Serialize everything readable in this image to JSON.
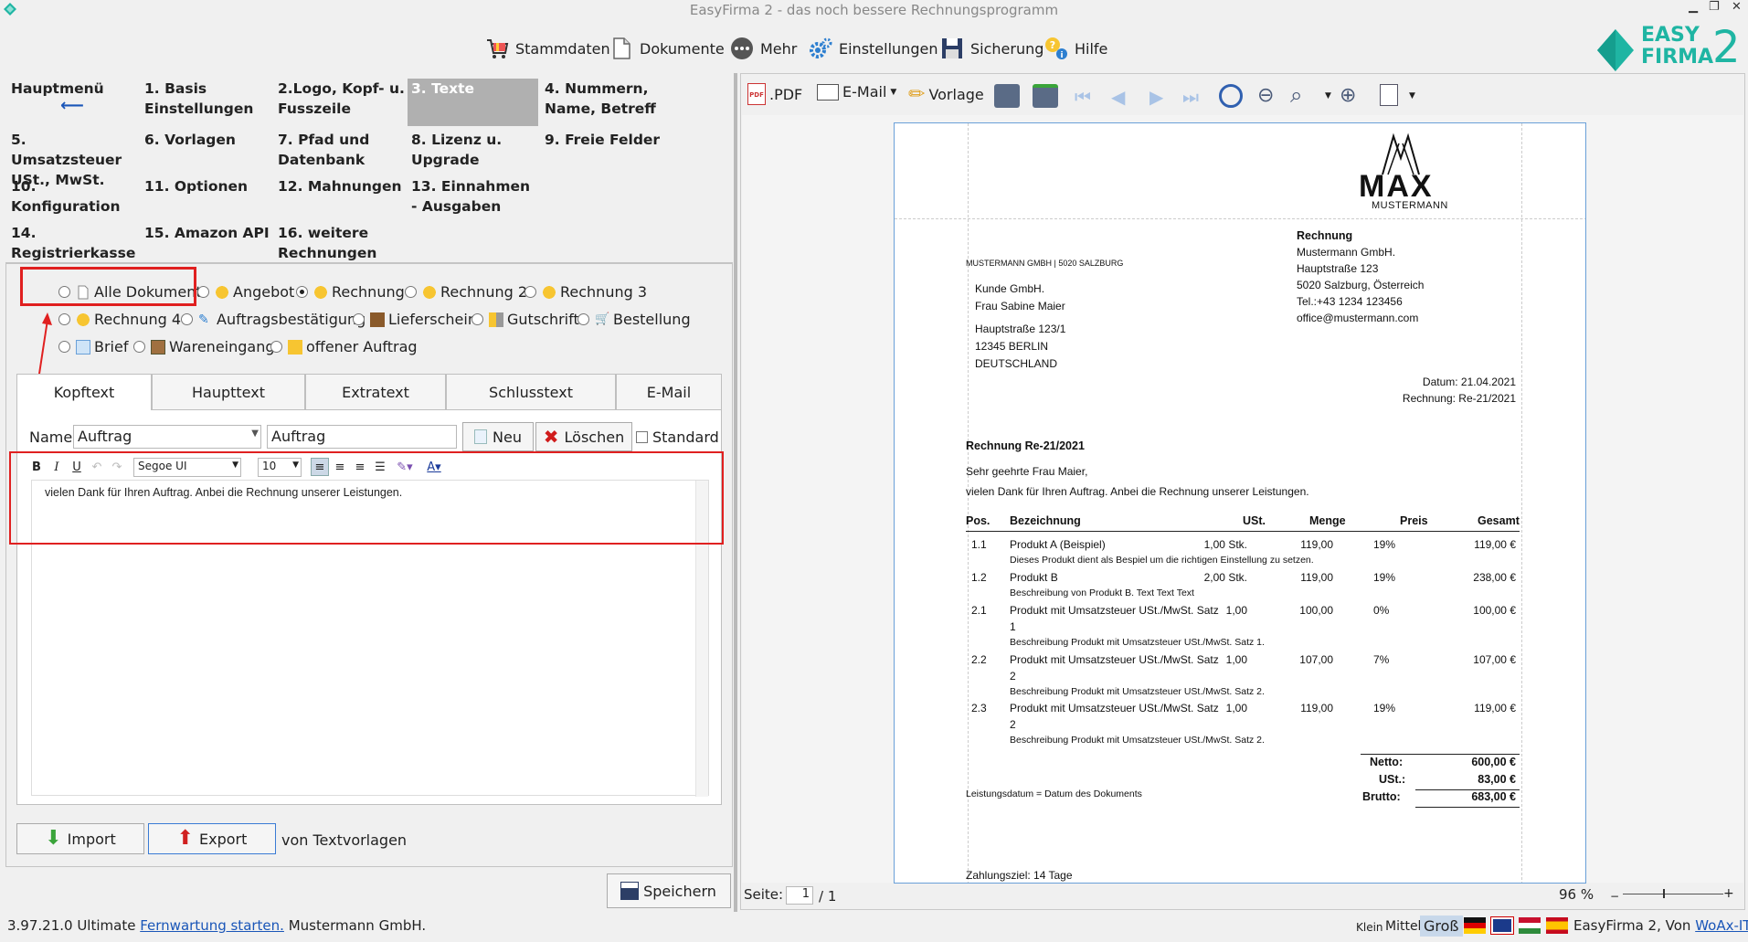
{
  "window": {
    "title": "EasyFirma 2 - das noch bessere Rechnungsprogramm",
    "logo_line1": "EASY",
    "logo_line2": "FIRMA",
    "logo_number": "2"
  },
  "toolbar": {
    "stammdaten": "Stammdaten",
    "dokumente": "Dokumente",
    "mehr": "Mehr",
    "einstellungen": "Einstellungen",
    "sicherung": "Sicherung",
    "hilfe": "Hilfe"
  },
  "nav": {
    "hauptmenu": "Hauptmenü",
    "items": [
      "1. Basis Einstellungen",
      "2.Logo, Kopf- u. Fusszeile",
      "3. Texte",
      "4. Nummern, Name, Betreff",
      "5. Umsatzsteuer USt., MwSt.",
      "6. Vorlagen",
      "7. Pfad und Datenbank",
      "8. Lizenz u. Upgrade",
      "9. Freie Felder",
      "10. Konfiguration",
      "11. Optionen",
      "12. Mahnungen",
      "13. Einnahmen - Ausgaben",
      "14. Registrierkasse",
      "15. Amazon API",
      "16. weitere Rechnungen"
    ]
  },
  "doc_types": {
    "alle": "Alle Dokument",
    "angebot": "Angebot",
    "rechnung": "Rechnung",
    "rechnung2": "Rechnung 2",
    "rechnung3": "Rechnung 3",
    "rechnung4": "Rechnung 4",
    "auftragsbestaetigung": "Auftragsbestätigung",
    "lieferschein": "Lieferschein",
    "gutschrift": "Gutschrift",
    "bestellung": "Bestellung",
    "brief": "Brief",
    "wareneingang": "Wareneingang",
    "offener_auftrag": "offener Auftrag"
  },
  "tabs": {
    "kopftext": "Kopftext",
    "haupttext": "Haupttext",
    "extratext": "Extratext",
    "schlusstext": "Schlusstext",
    "email": "E-Mail"
  },
  "form": {
    "name_label": "Name:",
    "name_value": "Auftrag",
    "name_text": "Auftrag",
    "neu": "Neu",
    "loeschen": "Löschen",
    "standard": "Standard"
  },
  "editor": {
    "font": "Segoe UI",
    "size": "10",
    "bold": "B",
    "italic": "I",
    "underline": "U",
    "content": "vielen Dank für Ihren Auftrag. Anbei die Rechnung unserer Leistungen."
  },
  "bottom": {
    "import": "Import",
    "export": "Export",
    "von_text": "von Textvorlagen",
    "speichern": "Speichern"
  },
  "preview_toolbar": {
    "pdf": ".PDF",
    "email": "E-Mail",
    "vorlage": "Vorlage",
    "seite_label": "Seite:",
    "seite_value": "1",
    "seite_total": "/ 1",
    "zoom": "96 %"
  },
  "invoice": {
    "logo_big": "MAX",
    "logo_small": "MUSTERMANN",
    "sender_line": "MUSTERMANN GMBH | 5020 SALZBURG",
    "doc_title": "Rechnung",
    "company": "Mustermann GmbH.",
    "street": "Hauptstraße 123",
    "city": "5020 Salzburg, Österreich",
    "tel": "Tel.:+43 1234 123456",
    "mail": "office@mustermann.com",
    "recipient": [
      "Kunde GmbH.",
      "Frau Sabine Maier",
      "Hauptstraße 123/1",
      "12345 BERLIN",
      "DEUTSCHLAND"
    ],
    "datum": "Datum: 21.04.2021",
    "rechnung_nr": "Rechnung: Re-21/2021",
    "heading": "Rechnung Re-21/2021",
    "greeting": "Sehr geehrte Frau Maier,",
    "intro": "vielen Dank für Ihren Auftrag. Anbei die Rechnung unserer Leistungen.",
    "columns": [
      "Pos.",
      "Bezeichnung",
      "USt.",
      "Menge",
      "Preis",
      "Gesamt"
    ],
    "rows": [
      {
        "pos": "1.1",
        "name": "Produkt A (Beispiel)",
        "qty": "1,00 Stk.",
        "price": "119,00",
        "tax": "19%",
        "total": "119,00 €",
        "desc": "Dieses Produkt dient als Bespiel um die richtigen Einstellung zu setzen."
      },
      {
        "pos": "1.2",
        "name": "Produkt B",
        "qty": "2,00 Stk.",
        "price": "119,00",
        "tax": "19%",
        "total": "238,00 €",
        "desc": "Beschreibung von Produkt B. Text Text Text"
      },
      {
        "pos": "2.1",
        "name": "Produkt mit Umsatzsteuer USt./MwSt. Satz",
        "name2": "1",
        "qty": "1,00",
        "price": "100,00",
        "tax": "0%",
        "total": "100,00 €",
        "desc": "Beschreibung Produkt mit Umsatzsteuer USt./MwSt. Satz 1."
      },
      {
        "pos": "2.2",
        "name": "Produkt mit Umsatzsteuer USt./MwSt. Satz",
        "name2": "2",
        "qty": "1,00",
        "price": "107,00",
        "tax": "7%",
        "total": "107,00 €",
        "desc": "Beschreibung Produkt mit Umsatzsteuer USt./MwSt. Satz 2."
      },
      {
        "pos": "2.3",
        "name": "Produkt mit Umsatzsteuer USt./MwSt. Satz",
        "name2": "2",
        "qty": "1,00",
        "price": "119,00",
        "tax": "19%",
        "total": "119,00 €",
        "desc": "Beschreibung Produkt mit Umsatzsteuer USt./MwSt. Satz 2."
      }
    ],
    "netto_label": "Netto:",
    "netto": "600,00 €",
    "ust_label": "USt.:",
    "ust": "83,00 €",
    "brutto_label": "Brutto:",
    "brutto": "683,00 €",
    "leistungsdatum": "Leistungsdatum = Datum des Dokuments",
    "zahlungsziel": "Zahlungsziel: 14 Tage"
  },
  "status": {
    "version": "3.97.21.0 Ultimate",
    "fernwartung": "Fernwartung starten.",
    "company": "Mustermann GmbH.",
    "klein": "Klein",
    "mittel": "Mittel",
    "gross": "Groß",
    "product": "EasyFirma 2, Von",
    "vendor": "WoAx-IT"
  },
  "colors": {
    "highlight_red": "#e02020",
    "logo_teal": "#1fb5a3",
    "link_blue": "#1a56b8"
  }
}
